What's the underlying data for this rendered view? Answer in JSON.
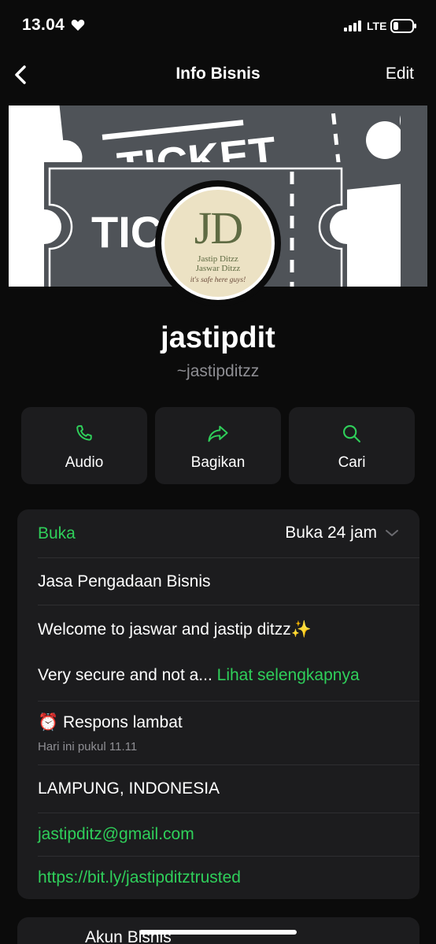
{
  "status": {
    "time": "13.04",
    "network": "LTE"
  },
  "nav": {
    "title": "Info Bisnis",
    "edit_label": "Edit"
  },
  "profile": {
    "name": "jastipdit",
    "handle": "~jastipditzz",
    "logo": {
      "monogram": "JD",
      "line1": "Jastip Ditzz",
      "line2": "Jaswar Ditzz",
      "tagline": "it's safe here guys!"
    },
    "cover_text": [
      "TICKET",
      "TIC"
    ]
  },
  "actions": [
    {
      "label": "Audio",
      "icon": "phone-icon"
    },
    {
      "label": "Bagikan",
      "icon": "share-icon"
    },
    {
      "label": "Cari",
      "icon": "search-icon"
    }
  ],
  "info": {
    "status_label": "Buka",
    "hours": "Buka 24 jam",
    "category": "Jasa Pengadaan Bisnis",
    "description_line1": "Welcome to jaswar and jastip ditzz✨",
    "description_line2": "Very secure and not a...",
    "see_more": "Lihat selengkapnya",
    "response_emoji": "⏰",
    "response": "Respons lambat",
    "response_time": "Hari ini pukul 11.11",
    "location": "LAMPUNG, INDONESIA",
    "email": "jastipditz@gmail.com",
    "website": "https://bit.ly/jastipditztrusted"
  },
  "account_section": {
    "label": "Akun Bisnis"
  },
  "colors": {
    "accent_green": "#2fcf5a",
    "card": "#1c1c1e",
    "background": "#0b0b0b"
  }
}
